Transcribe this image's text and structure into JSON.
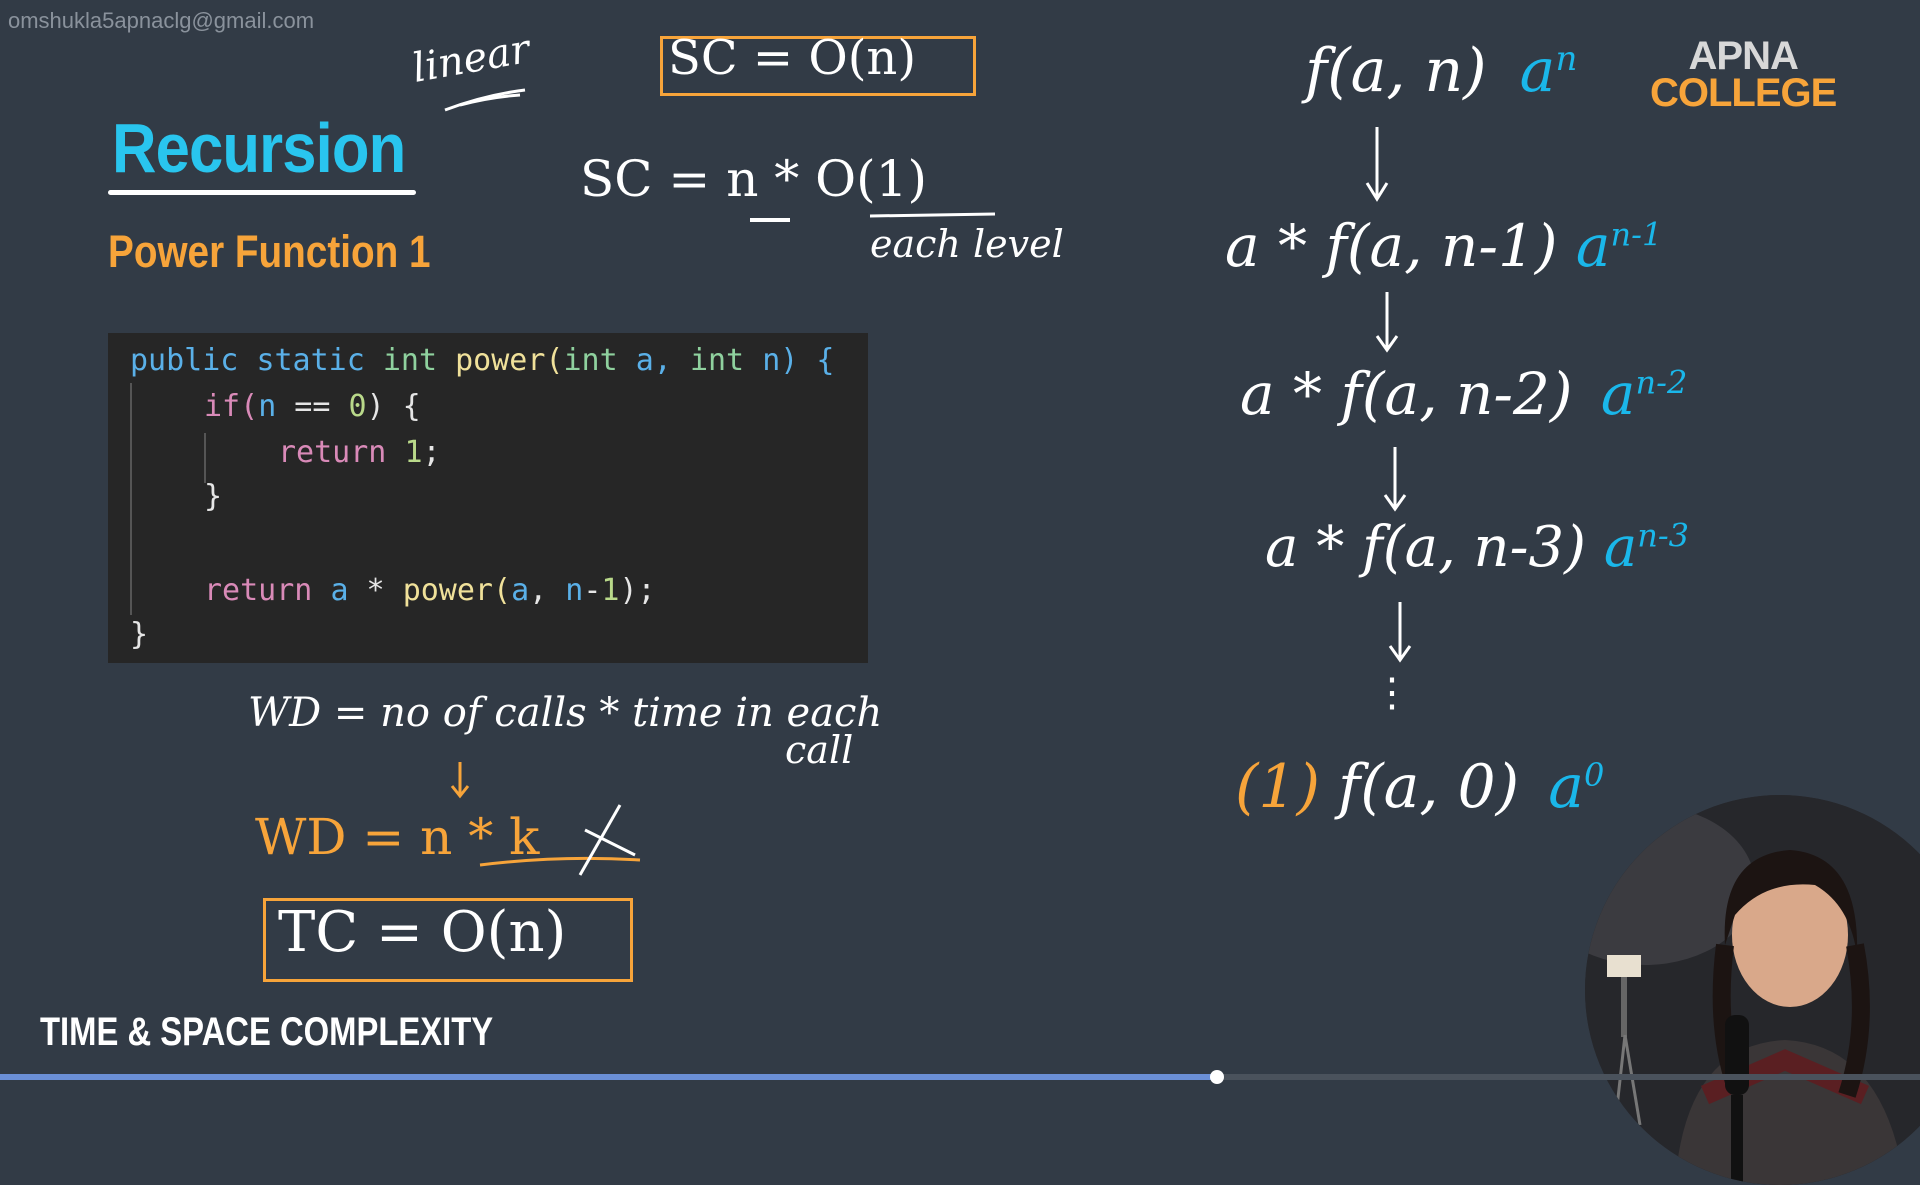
{
  "watermark": "omshukla5apnaclg@gmail.com",
  "brand": {
    "line1": "APNA",
    "line2": "COLLEGE"
  },
  "title": "Recursion",
  "subtitle": "Power Function 1",
  "footer": "TIME & SPACE COMPLEXITY",
  "code": {
    "line1": [
      "public",
      "static",
      "int",
      "power(",
      "int",
      "a,",
      "int",
      "n) {"
    ],
    "line2": [
      "if(",
      "n",
      " == ",
      "0",
      ") {"
    ],
    "line3": [
      "return",
      "1",
      ";"
    ],
    "line4": "}",
    "line5": [
      "return",
      "a",
      " * ",
      "power(",
      "a",
      ", ",
      "n",
      "-",
      "1",
      ");"
    ],
    "line6": "}"
  },
  "notes": {
    "linear": "linear",
    "sc_box": "SC = O(n)",
    "sc_expr": "SC =  n * O(1)",
    "sc_note": "each level",
    "wd_def": "WD = no of calls * time in each",
    "wd_def2": "call",
    "wd_val": "WD =  n * k",
    "tc_box": "TC = O(n)"
  },
  "tree": {
    "levels": [
      {
        "expr": "f(a, n)",
        "pow": "a",
        "exp": "n"
      },
      {
        "expr": "a * f(a, n-1)",
        "pow": "a",
        "exp": "n-1"
      },
      {
        "expr": "a * f(a, n-2)",
        "pow": "a",
        "exp": "n-2"
      },
      {
        "expr": "a * f(a, n-3)",
        "pow": "a",
        "exp": "n-3"
      },
      {
        "expr": "f(a, 0)",
        "pow": "a",
        "exp": "0",
        "prefix": "(1)"
      }
    ],
    "ellipsis": "⋮"
  },
  "video": {
    "progress": 0.634
  },
  "colors": {
    "background": "#323b46",
    "accent_orange": "#f7a43a",
    "accent_blue": "#1ab7ea",
    "title": "#29c5ee"
  }
}
